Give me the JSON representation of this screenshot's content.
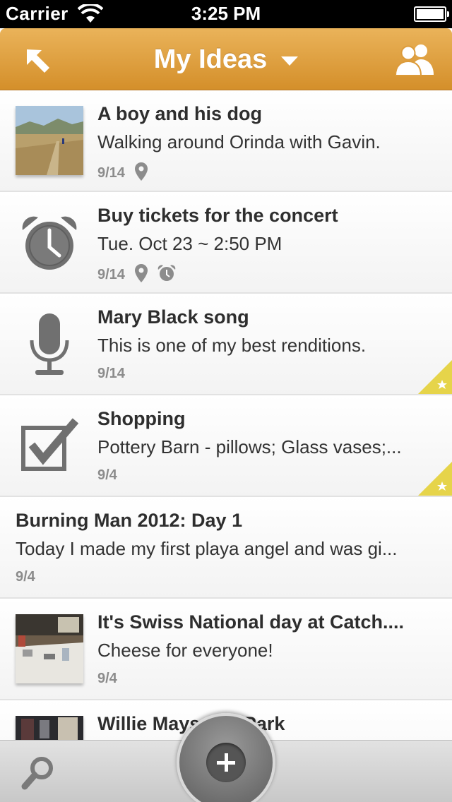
{
  "status_bar": {
    "carrier": "Carrier",
    "time": "3:25 PM"
  },
  "nav": {
    "title": "My Ideas"
  },
  "items": [
    {
      "title": "A boy and his dog",
      "subtitle": "Walking around Orinda with Gavin.",
      "date": "9/14",
      "has_location": true,
      "has_alarm": false,
      "starred": false,
      "thumb": "photo-hike"
    },
    {
      "title": "Buy tickets for the concert",
      "subtitle": "Tue. Oct 23 ~ 2:50 PM",
      "date": "9/14",
      "has_location": true,
      "has_alarm": true,
      "starred": false,
      "thumb": "alarm-clock-icon"
    },
    {
      "title": "Mary Black song",
      "subtitle": "This is one of my best renditions.",
      "date": "9/14",
      "has_location": false,
      "has_alarm": false,
      "starred": true,
      "thumb": "microphone-icon"
    },
    {
      "title": "Shopping",
      "subtitle": "Pottery Barn - pillows; Glass vases;...",
      "date": "9/4",
      "has_location": false,
      "has_alarm": false,
      "starred": true,
      "thumb": "checkbox-icon"
    },
    {
      "title": "Burning Man 2012: Day 1",
      "subtitle": "Today I made my first playa angel and was gi...",
      "date": "9/4",
      "has_location": false,
      "has_alarm": false,
      "starred": false,
      "thumb": "none"
    },
    {
      "title": "It's Swiss National day at Catch....",
      "subtitle": "Cheese for everyone!",
      "date": "9/4",
      "has_location": false,
      "has_alarm": false,
      "starred": false,
      "thumb": "photo-table"
    },
    {
      "title": "Willie Mays ... T Park",
      "subtitle": "",
      "date": "",
      "has_location": false,
      "has_alarm": false,
      "starred": false,
      "thumb": "photo-poster"
    }
  ],
  "colors": {
    "nav_orange": "#e0a040",
    "star_yellow": "#e6d44a",
    "icon_gray": "#707070"
  },
  "bottom_bar": {
    "search_icon": "search-icon",
    "add_icon": "add-icon"
  }
}
